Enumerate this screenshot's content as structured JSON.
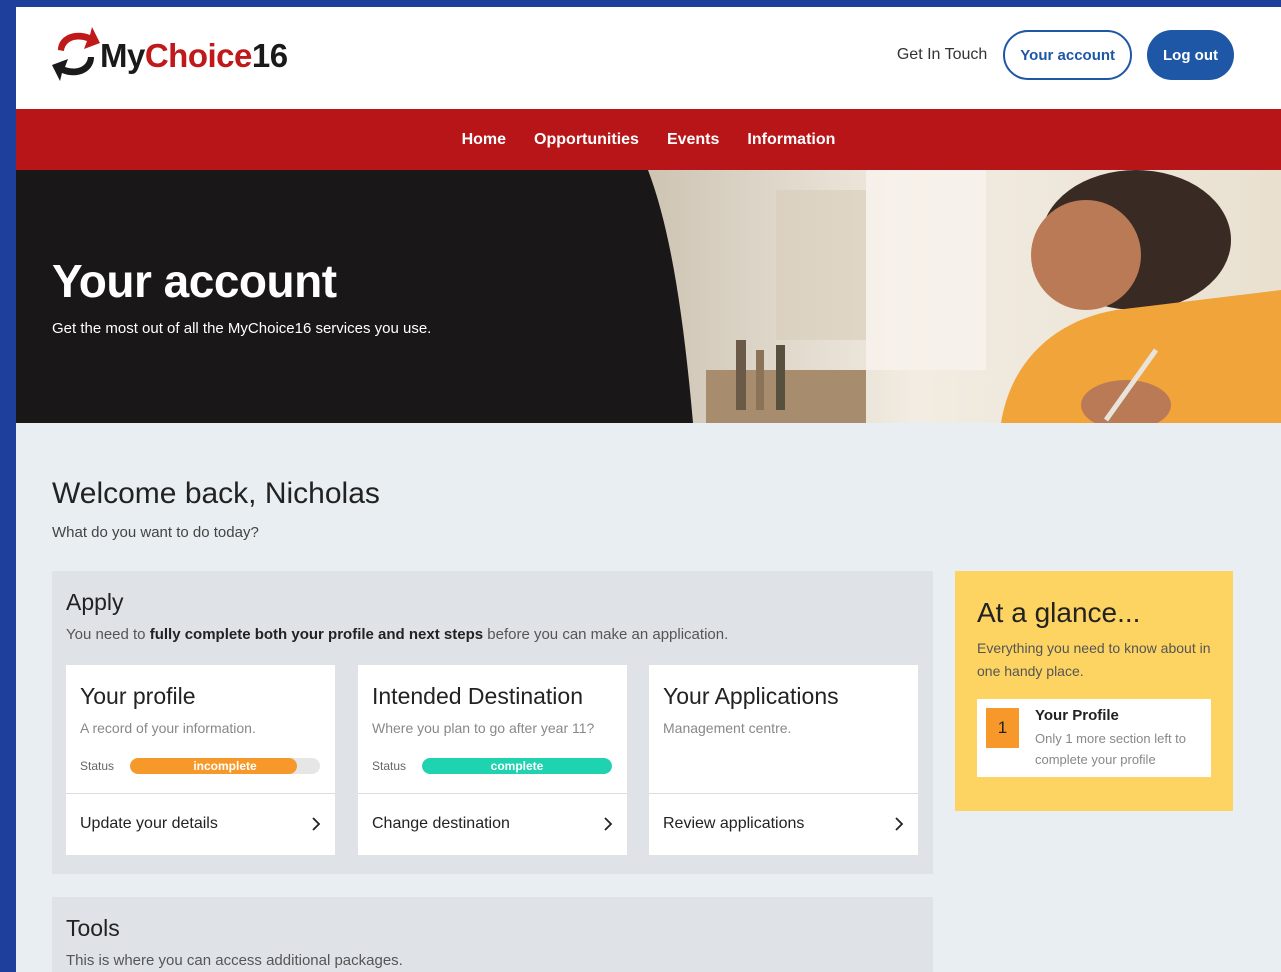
{
  "header": {
    "logo": {
      "my": "My",
      "choice": "Choice",
      "num": "16"
    },
    "get_in_touch": "Get In Touch",
    "your_account": "Your account",
    "log_out": "Log out"
  },
  "nav": [
    "Home",
    "Opportunities",
    "Events",
    "Information"
  ],
  "hero": {
    "title": "Your account",
    "subtitle": "Get the most out of all the MyChoice16 services you use."
  },
  "welcome": {
    "title": "Welcome back, Nicholas",
    "subtitle": "What do you want to do today?"
  },
  "apply": {
    "title": "Apply",
    "desc_prefix": "You need to ",
    "desc_bold": "fully complete both your profile and next steps",
    "desc_suffix": " before you can make an application.",
    "cards": [
      {
        "title": "Your profile",
        "subtitle": "A record of your information.",
        "status_label": "Status",
        "status": "incomplete",
        "progress": 0.88,
        "color": "#f7982b",
        "action": "Update your details"
      },
      {
        "title": "Intended Destination",
        "subtitle": "Where you plan to go after year 11?",
        "status_label": "Status",
        "status": "complete",
        "progress": 1.0,
        "color": "#1fd3b0",
        "action": "Change destination"
      },
      {
        "title": "Your Applications",
        "subtitle": "Management centre.",
        "action": "Review applications"
      }
    ]
  },
  "glance": {
    "title": "At a glance...",
    "desc": "Everything you need to know about in one handy place.",
    "item": {
      "number": "1",
      "title": "Your Profile",
      "text": "Only 1 more section left to complete your profile"
    }
  },
  "tools": {
    "title": "Tools",
    "desc": "This is where you can access additional packages."
  },
  "colors": {
    "brand_red": "#b71518",
    "brand_blue": "#1e57a6",
    "glance_yellow": "#fdd361",
    "incomplete_orange": "#f7982b",
    "complete_teal": "#1fd3b0"
  },
  "icons": [
    "logo-arrows-icon",
    "chevron-right-icon"
  ]
}
